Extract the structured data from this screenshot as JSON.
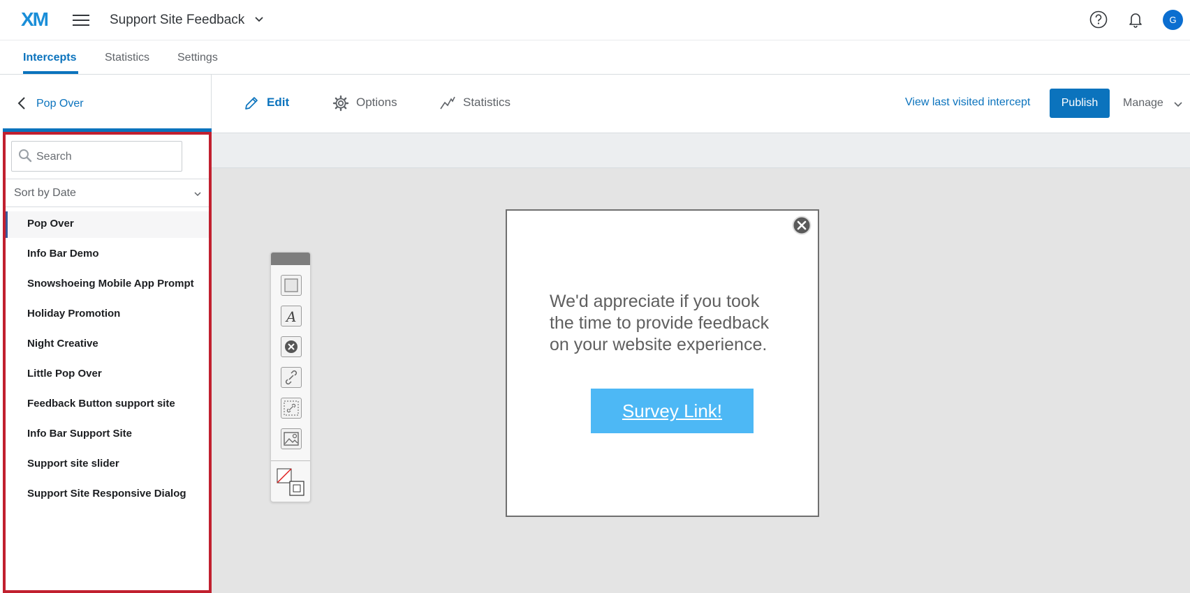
{
  "header": {
    "logo": "XM",
    "project_title": "Support Site Feedback",
    "avatar_initial": "G"
  },
  "main_tabs": [
    {
      "label": "Intercepts",
      "active": true
    },
    {
      "label": "Statistics",
      "active": false
    },
    {
      "label": "Settings",
      "active": false
    }
  ],
  "left_panel": {
    "title": "Pop Over",
    "search": {
      "placeholder": "Search",
      "value": ""
    },
    "sort_label": "Sort by Date",
    "items": [
      {
        "label": "Pop Over",
        "selected": true
      },
      {
        "label": "Info Bar Demo",
        "selected": false
      },
      {
        "label": "Snowshoeing Mobile App Prompt",
        "selected": false
      },
      {
        "label": "Holiday Promotion",
        "selected": false
      },
      {
        "label": "Night Creative",
        "selected": false
      },
      {
        "label": "Little Pop Over",
        "selected": false
      },
      {
        "label": "Feedback Button support site",
        "selected": false
      },
      {
        "label": "Info Bar Support Site",
        "selected": false
      },
      {
        "label": "Support site slider",
        "selected": false
      },
      {
        "label": "Support Site Responsive Dialog",
        "selected": false
      }
    ]
  },
  "toolbar": {
    "edit_label": "Edit",
    "options_label": "Options",
    "statistics_label": "Statistics",
    "view_last_label": "View last visited intercept",
    "publish_label": "Publish",
    "manage_label": "Manage"
  },
  "widget_tools": [
    "rectangle-icon",
    "text-icon",
    "close-button-icon",
    "link-icon",
    "target-link-icon",
    "image-icon",
    "color-swatch-icon"
  ],
  "creative": {
    "message": "We'd appreciate if you took the time to provide feedback on your website experience.",
    "button_label": "Survey Link!"
  },
  "colors": {
    "accent": "#0b73bd",
    "highlight_border": "#c1202f",
    "survey_button": "#4db8f5"
  }
}
